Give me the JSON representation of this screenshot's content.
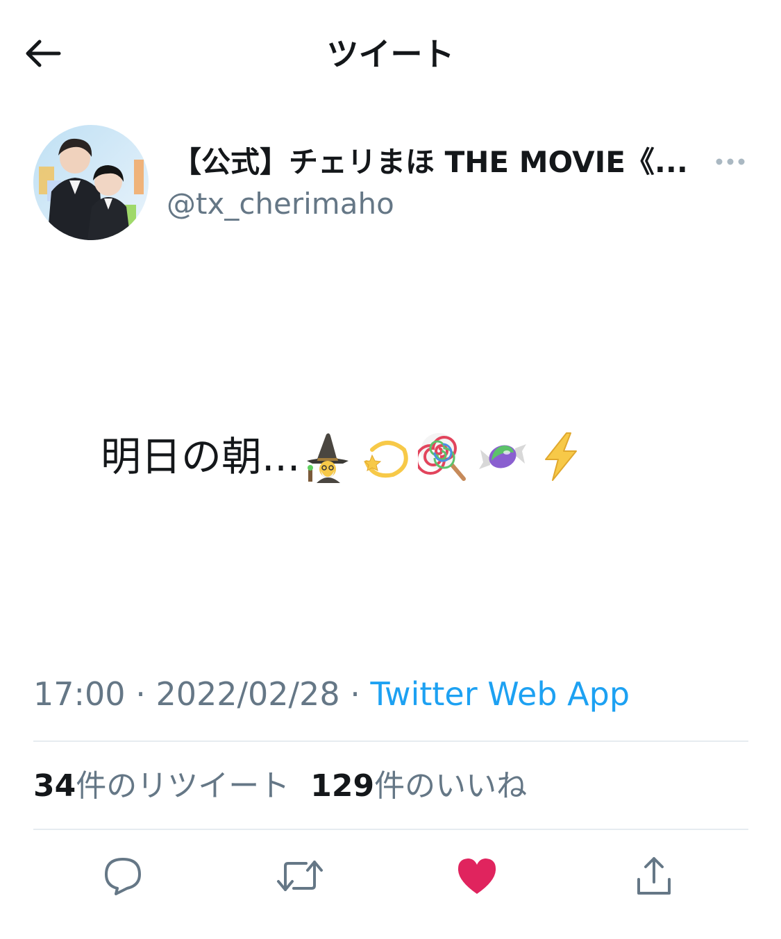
{
  "header": {
    "title": "ツイート",
    "back_icon": "arrow-left-icon"
  },
  "author": {
    "display_name": "【公式】チェリまほ THE MOVIE《...",
    "handle": "@tx_cherimaho",
    "more_icon": "more-horizontal-icon"
  },
  "tweet": {
    "text": "明日の朝...",
    "emojis": [
      "mage-emoji",
      "dizzy-emoji",
      "lollipop-emoji",
      "candy-emoji",
      "lightning-emoji"
    ]
  },
  "meta": {
    "time": "17:00",
    "sep1": " · ",
    "date": "2022/02/28",
    "sep2": " · ",
    "source": "Twitter Web App"
  },
  "stats": {
    "retweets_count": "34",
    "retweets_label": "件のリツイート",
    "likes_count": "129",
    "likes_label": "件のいいね"
  },
  "actions": {
    "reply_icon": "reply-icon",
    "retweet_icon": "retweet-icon",
    "like_icon": "heart-icon",
    "share_icon": "share-icon",
    "liked": true
  },
  "colors": {
    "accent": "#1da1f2",
    "like": "#e0245e",
    "secondary_text": "#657786",
    "divider": "#e6ecf0"
  }
}
